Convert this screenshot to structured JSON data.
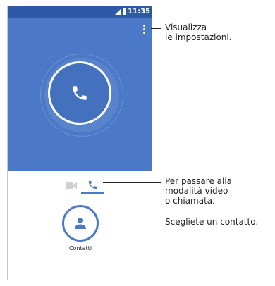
{
  "status_bar": {
    "time": "11:35",
    "signal_icon": "signal-icon",
    "battery_icon": "battery-icon"
  },
  "main": {
    "menu_icon": "more-vertical-icon",
    "call_icon": "phone-icon",
    "modes": {
      "video_icon": "video-camera-icon",
      "voice_icon": "phone-icon",
      "selected": "voice"
    },
    "contacts": {
      "icon": "person-icon",
      "label": "Contatti"
    }
  },
  "callouts": {
    "settings": [
      "Visualizza",
      "le impostazioni."
    ],
    "mode": [
      "Per passare alla",
      "modalità video",
      "o chiamata."
    ],
    "contact": [
      "Scegliete un contatto."
    ]
  },
  "colors": {
    "status_bar": "#2e58a8",
    "hero": "#4b79c8",
    "accent": "#4b79c8",
    "icon_inactive": "#cfcfcf"
  }
}
